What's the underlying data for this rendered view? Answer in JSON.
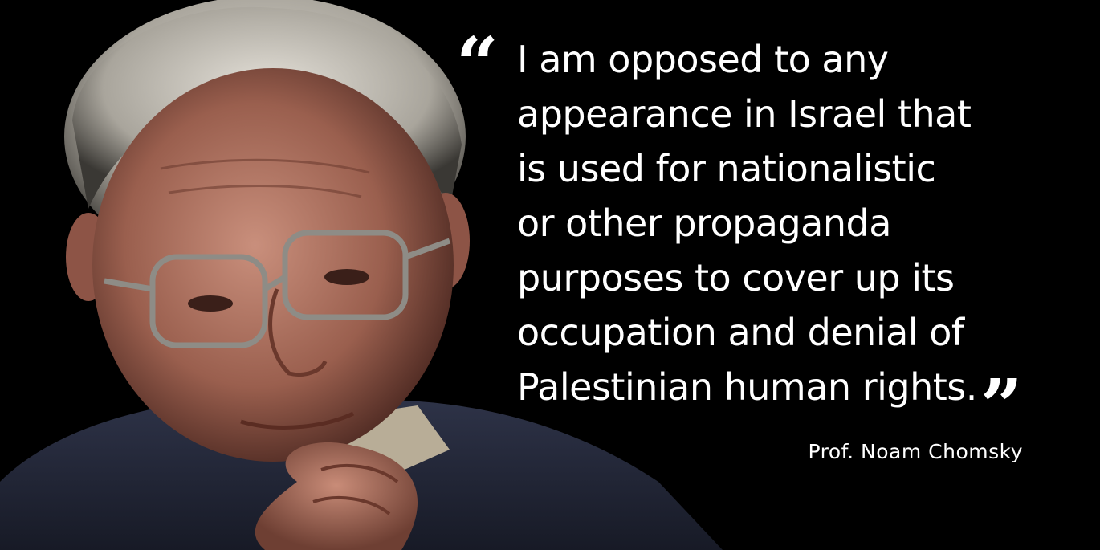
{
  "quote": {
    "open_mark": "“",
    "close_mark": "”",
    "lines": [
      "I am opposed to any",
      "appearance in Israel that",
      "is used for nationalistic",
      "or other propaganda",
      "purposes to cover up its",
      "occupation and denial of",
      "Palestinian human rights."
    ]
  },
  "attribution": "Prof. Noam Chomsky",
  "colors": {
    "background": "#000000",
    "text": "#ffffff"
  }
}
